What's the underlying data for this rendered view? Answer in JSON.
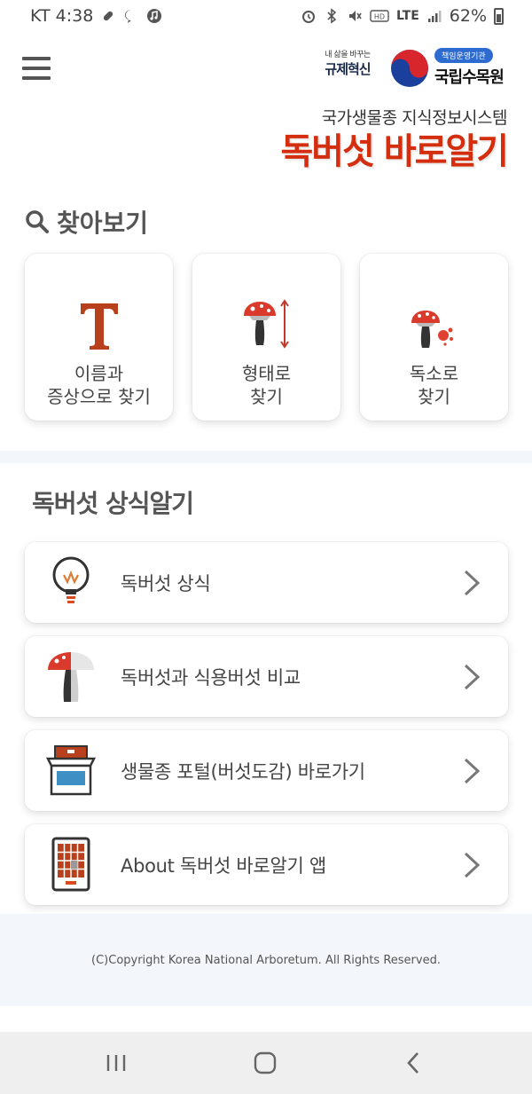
{
  "status_bar": {
    "carrier_time": "KT 4:38",
    "network": "LTE",
    "battery": "62%",
    "icons": [
      "link-icon",
      "chat-icon",
      "music-icon",
      "alarm-icon",
      "bluetooth-icon",
      "mute-icon",
      "hd-icon",
      "signal-icon",
      "battery-icon"
    ]
  },
  "header": {
    "menu_icon": "hamburger-menu-icon",
    "logo_regulation": {
      "small_text": "내 삶을 바꾸는",
      "big_text": "규제혁신"
    },
    "logo_agency": {
      "badge": "책임운영기관",
      "name": "국립수목원"
    },
    "subtitle": "국가생물종 지식정보시스템",
    "title": "독버섯 바로알기"
  },
  "search_section": {
    "icon": "search-icon",
    "title": "찾아보기",
    "cards": [
      {
        "label": "이름과\n증상으로 찾기",
        "icon": "text-t-icon"
      },
      {
        "label": "형태로\n찾기",
        "icon": "mushroom-shape-icon"
      },
      {
        "label": "독소로\n찾기",
        "icon": "mushroom-toxin-icon"
      }
    ]
  },
  "knowledge_section": {
    "title": "독버섯 상식알기",
    "items": [
      {
        "label": "독버섯 상식",
        "icon": "lightbulb-icon"
      },
      {
        "label": "독버섯과 식용버섯 비교",
        "icon": "mushroom-compare-icon"
      },
      {
        "label": "생물종 포털(버섯도감) 바로가기",
        "icon": "box-portal-icon"
      },
      {
        "label": "About 독버섯 바로알기 앱",
        "icon": "tablet-app-icon"
      }
    ]
  },
  "footer": {
    "copyright": "(C)Copyright Korea National Arboretum. All Rights Reserved."
  },
  "nav_bar": {
    "buttons": [
      "recent-apps-icon",
      "home-icon",
      "back-icon"
    ]
  },
  "colors": {
    "brand_red": "#d42e0e",
    "section_bg": "#f3f6fb",
    "agency_blue": "#2d6bd1"
  }
}
